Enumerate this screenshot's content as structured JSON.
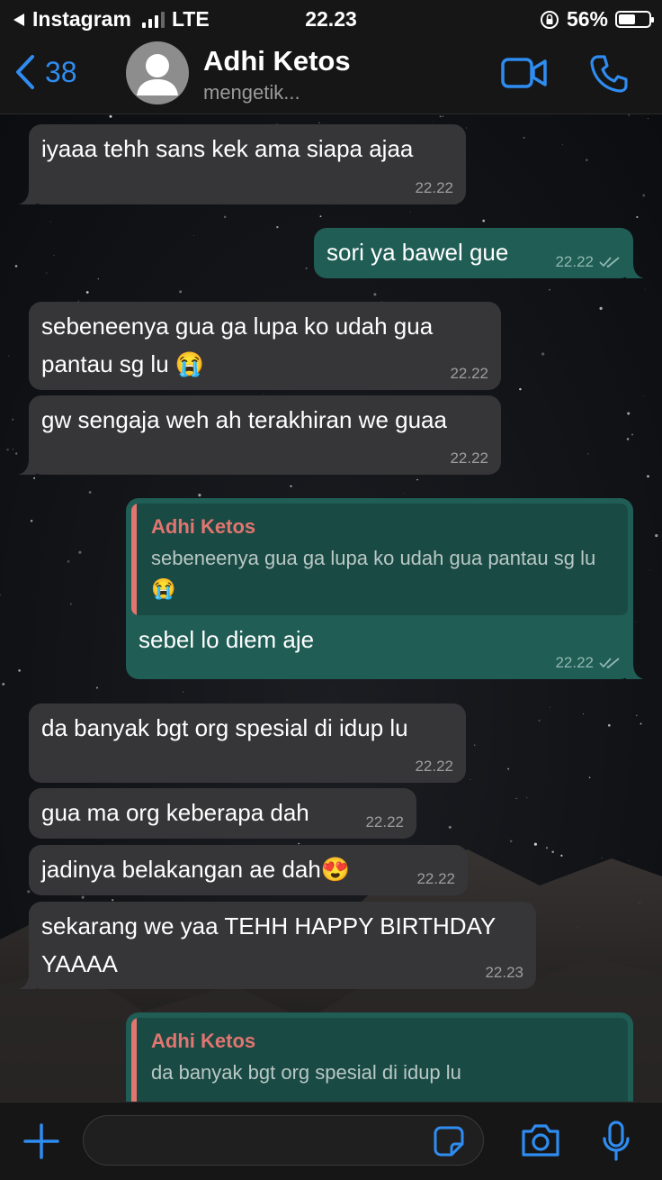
{
  "status_bar": {
    "back_app": "Instagram",
    "network": "LTE",
    "time": "22.23",
    "battery": "56%",
    "battery_level": 0.56
  },
  "header": {
    "back_count": "38",
    "contact_name": "Adhi Ketos",
    "contact_status": "mengetik..."
  },
  "colors": {
    "accent": "#2f8cf0",
    "incoming_bubble": "#363638",
    "outgoing_bubble": "#1f5d55",
    "quote_name": "#e27570"
  },
  "messages": [
    {
      "dir": "in",
      "text": "iyaaa tehh sans kek ama siapa ajaa",
      "time": "22.22"
    },
    {
      "dir": "out",
      "text": "sori ya bawel gue",
      "time": "22.22"
    },
    {
      "dir": "in",
      "text": "sebeneenya gua ga lupa ko udah gua pantau sg lu 😭",
      "time": "22.22"
    },
    {
      "dir": "in",
      "text": "gw sengaja weh ah terakhiran we guaa",
      "time": "22.22"
    },
    {
      "dir": "out",
      "quote_name": "Adhi Ketos",
      "quote_text": "sebeneenya gua ga lupa ko udah gua pantau sg lu 😭",
      "text": "sebel lo diem aje",
      "time": "22.22"
    },
    {
      "dir": "in",
      "text": "da banyak bgt org spesial di idup lu",
      "time": "22.22"
    },
    {
      "dir": "in",
      "text": "gua ma org keberapa dah",
      "time": "22.22"
    },
    {
      "dir": "in",
      "text": "jadinya belakangan ae dah😍",
      "time": "22.22"
    },
    {
      "dir": "in",
      "text": "sekarang we yaa TEHH HAPPY BIRTHDAY YAAAA",
      "time": "22.23"
    },
    {
      "dir": "out",
      "quote_name": "Adhi Ketos",
      "quote_text": "da banyak bgt org spesial di idup lu"
    }
  ],
  "input": {
    "placeholder": ""
  }
}
